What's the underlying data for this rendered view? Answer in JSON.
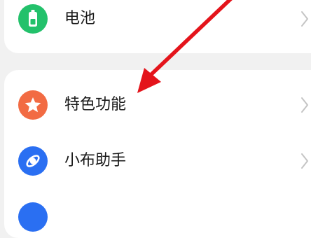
{
  "settings": {
    "items": [
      {
        "label": "电池",
        "icon": "battery-icon",
        "color": "#23c16b"
      },
      {
        "label": "特色功能",
        "icon": "star-icon",
        "color": "#f26b43"
      },
      {
        "label": "小布助手",
        "icon": "assistant-icon",
        "color": "#2a6ff2"
      },
      {
        "label": "",
        "icon": "partial-icon",
        "color": "#2a6ff2"
      }
    ]
  },
  "annotation": {
    "arrow_color": "#e4141b"
  }
}
